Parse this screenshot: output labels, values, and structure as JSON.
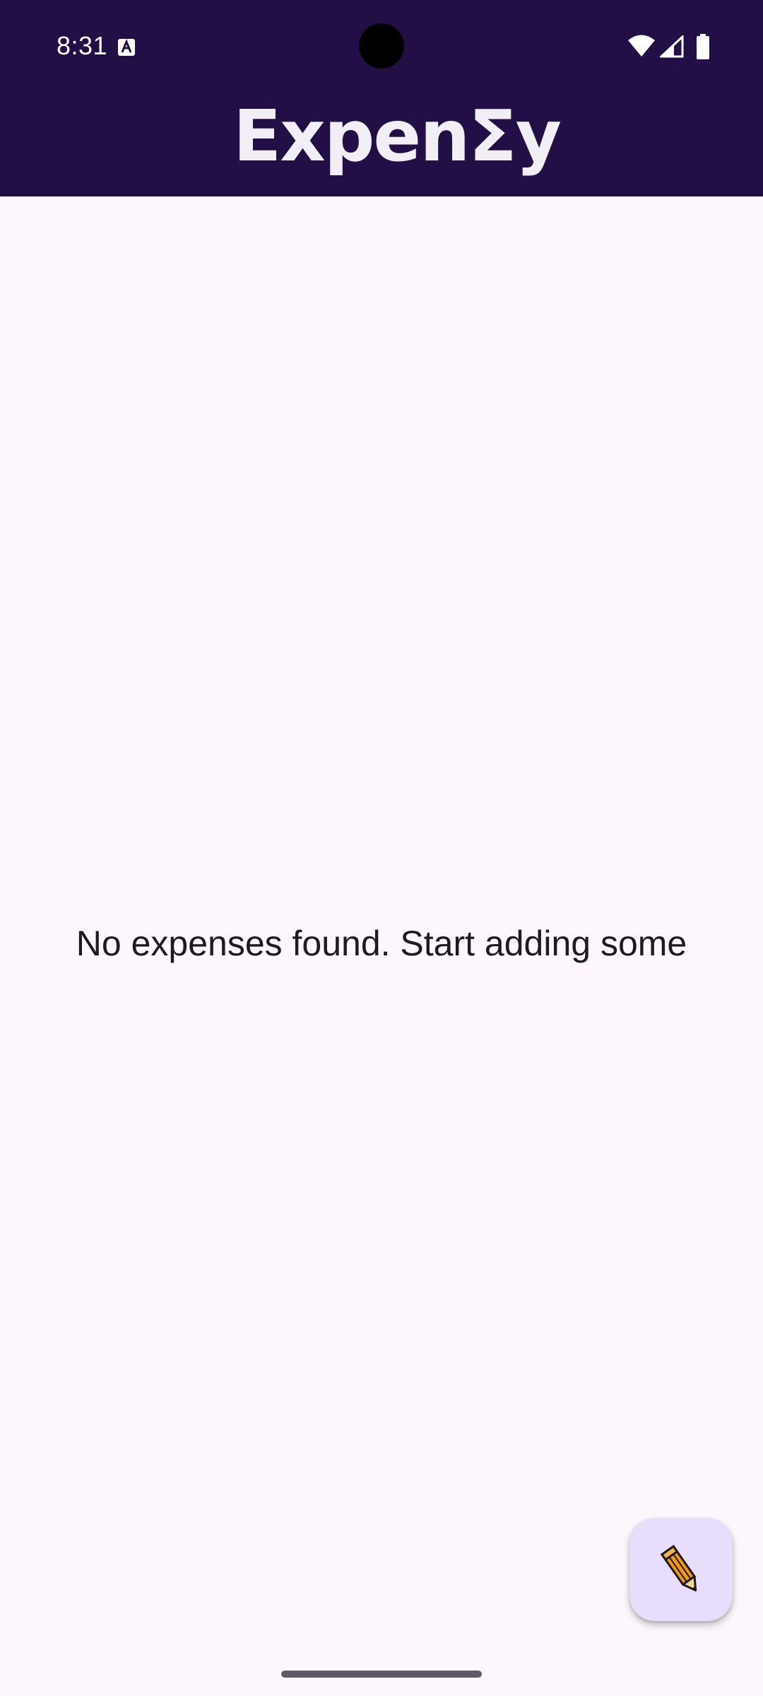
{
  "status_bar": {
    "time": "8:31",
    "icons": [
      "notification-a-icon",
      "wifi-icon",
      "signal-icon",
      "battery-icon"
    ]
  },
  "app_bar": {
    "title": "ExpenΣy",
    "background_color": "#210f45",
    "title_color": "#f2eef6"
  },
  "main": {
    "empty_message": "No expenses found. Start adding some",
    "background_color": "#fdf6fd"
  },
  "fab": {
    "icon": "pencil-icon",
    "background_color": "#e9ddfc",
    "icon_color": "#f29a0f"
  }
}
